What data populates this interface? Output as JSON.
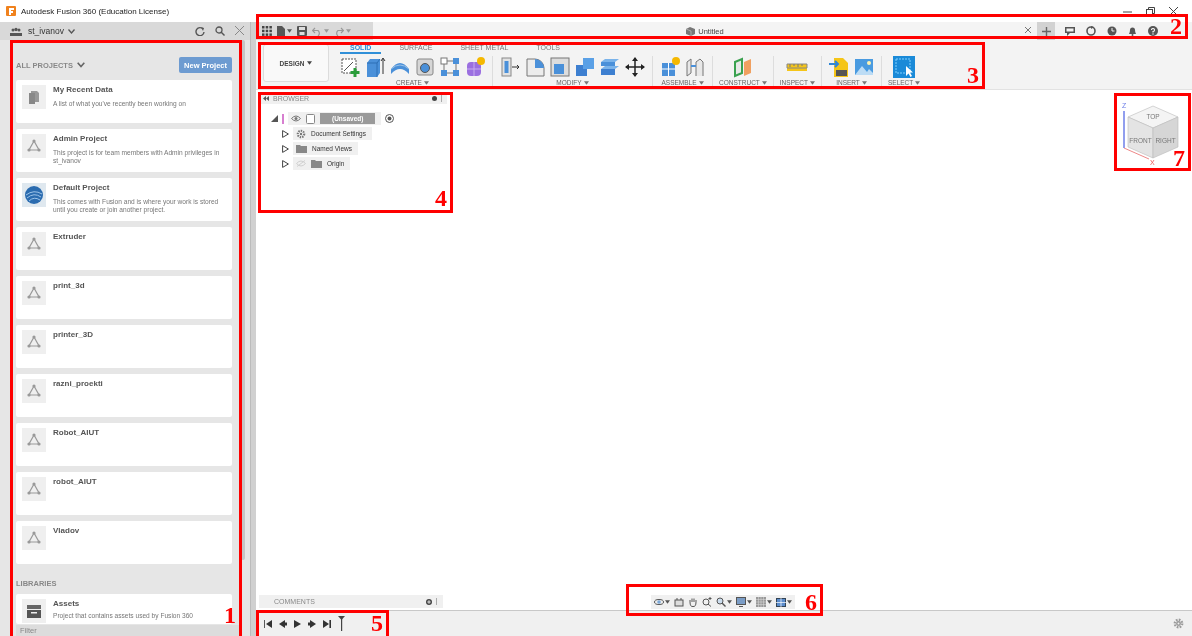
{
  "window": {
    "title": "Autodesk Fusion 360 (Education License)"
  },
  "data_panel": {
    "team": "st_ivanov",
    "section_title": "ALL PROJECTS",
    "new_project_button": "New Project",
    "projects": [
      {
        "name": "My Recent Data",
        "description": "A list of what you've recently been working on",
        "kind": "recent"
      },
      {
        "name": "Admin Project",
        "description": "This project is for team members with Admin privileges in st_ivanov",
        "kind": "project"
      },
      {
        "name": "Default Project",
        "description": "This comes with Fusion and is where your work is stored until you create or join another project.",
        "kind": "default"
      },
      {
        "name": "Extruder",
        "kind": "project"
      },
      {
        "name": "print_3d",
        "kind": "project"
      },
      {
        "name": "printer_3D",
        "kind": "project"
      },
      {
        "name": "razni_proekti",
        "kind": "project"
      },
      {
        "name": "Robot_AIUT",
        "kind": "project"
      },
      {
        "name": "robot_AIUT",
        "kind": "project"
      },
      {
        "name": "Vladov",
        "kind": "project"
      }
    ],
    "libraries_title": "LIBRARIES",
    "libraries": [
      {
        "name": "Assets",
        "description": "Project that contains assets used by Fusion 360",
        "kind": "library"
      }
    ],
    "filter": {
      "placeholder": "Filter"
    }
  },
  "app_bar": {
    "document_tab": "Untitled"
  },
  "ribbon": {
    "workspace": "DESIGN",
    "tabs": [
      {
        "label": "SOLID",
        "selected": true
      },
      {
        "label": "SURFACE",
        "selected": false
      },
      {
        "label": "SHEET METAL",
        "selected": false
      },
      {
        "label": "TOOLS",
        "selected": false
      }
    ],
    "groups": [
      {
        "label": "CREATE"
      },
      {
        "label": "MODIFY"
      },
      {
        "label": "ASSEMBLE"
      },
      {
        "label": "CONSTRUCT"
      },
      {
        "label": "INSPECT"
      },
      {
        "label": "INSERT"
      },
      {
        "label": "SELECT"
      }
    ]
  },
  "browser": {
    "title": "BROWSER",
    "tree": [
      {
        "label": "(Unsaved)",
        "expanded": true,
        "visible": true,
        "children": [
          {
            "label": "Document Settings",
            "expanded": false
          },
          {
            "label": "Named Views",
            "expanded": false
          },
          {
            "label": "Origin",
            "expanded": false,
            "visible": false
          }
        ]
      }
    ]
  },
  "comments": {
    "title": "COMMENTS"
  },
  "view_cube": {
    "faces": [
      "TOP",
      "FRONT",
      "RIGHT"
    ],
    "axes": [
      "Z",
      "X"
    ]
  },
  "annotations": [
    {
      "label": "1"
    },
    {
      "label": "2"
    },
    {
      "label": "3"
    },
    {
      "label": "4"
    },
    {
      "label": "5"
    },
    {
      "label": "6"
    },
    {
      "label": "7"
    }
  ]
}
